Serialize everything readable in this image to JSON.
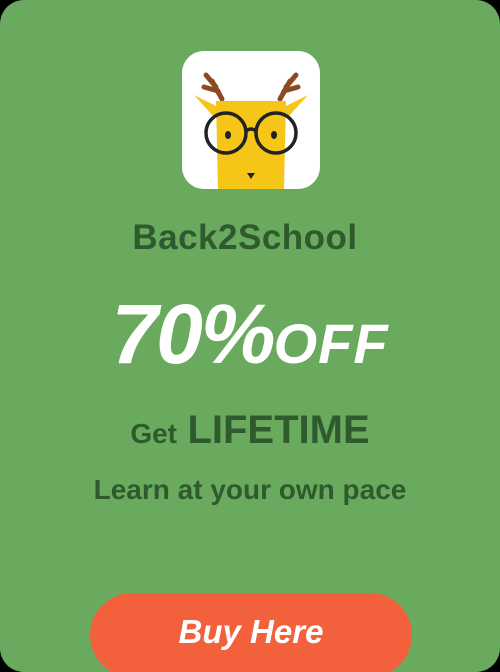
{
  "promo": {
    "name": "Back2School",
    "discount_percent": "70%",
    "discount_suffix": "OFF",
    "plan_prefix": "Get",
    "plan_name": "LIFETIME",
    "tagline": "Learn at your own pace",
    "button_label": "Buy Here"
  },
  "icons": {
    "app_icon": "deer-with-glasses-logo-icon"
  },
  "colors": {
    "card_background": "#6aaa5e",
    "heading_text": "#2e5a2e",
    "discount_text": "#ffffff",
    "button_background": "#f2613b",
    "button_text": "#ffffff",
    "logo_yellow": "#f5c518",
    "logo_antler": "#8b4a22"
  }
}
